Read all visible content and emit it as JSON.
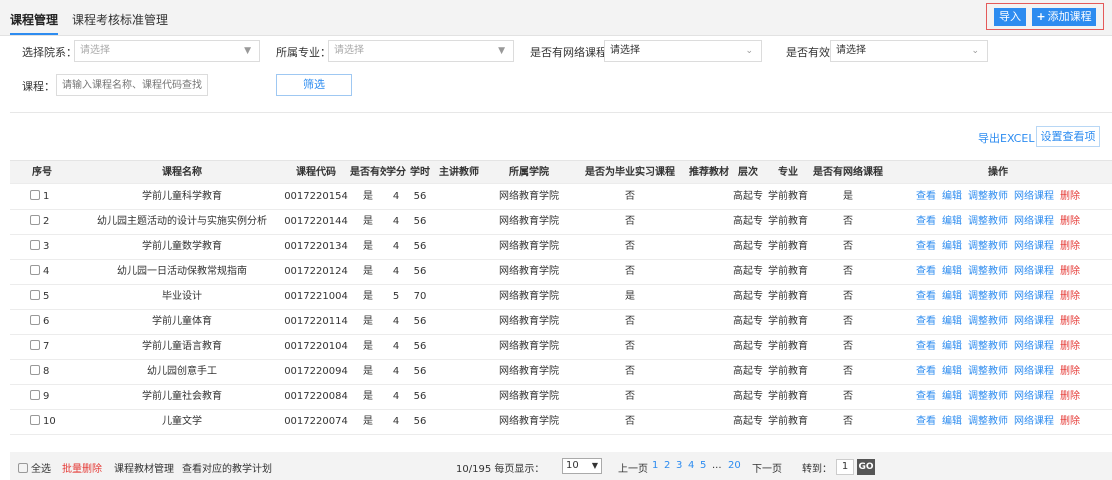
{
  "tabs": [
    {
      "label": "课程管理",
      "active": true
    },
    {
      "label": "课程考核标准管理",
      "active": false
    }
  ],
  "top_actions": {
    "import_label": "导入",
    "add_label": "添加课程",
    "add_icon": "plus-icon",
    "accent": "#2d8cf0",
    "highlight_border": "#e45a5a"
  },
  "filters": {
    "college": {
      "label": "选择院系：",
      "placeholder": "请选择"
    },
    "major": {
      "label": "所属专业：",
      "placeholder": "请选择"
    },
    "online": {
      "label": "是否有网络课程:",
      "value": "请选择"
    },
    "valid": {
      "label": "是否有效:",
      "value": "请选择"
    },
    "course": {
      "label": "课程：",
      "placeholder": "请输入课程名称、课程代码查找"
    },
    "submit_label": "筛选"
  },
  "toolbar": {
    "export_label": "导出EXCEL",
    "config_label": "设置查看项"
  },
  "table": {
    "headers": {
      "no": "序号",
      "name": "课程名称",
      "code": "课程代码",
      "valid": "是否有效",
      "credit": "学分",
      "hours": "学时",
      "teacher": "主讲教师",
      "college": "所属学院",
      "intern": "是否为毕业实习课程",
      "book": "推荐教材",
      "level": "层次",
      "major": "专业",
      "online": "是否有网络课程",
      "ops": "操作"
    },
    "ops": {
      "view": "查看",
      "edit": "编辑",
      "adjust": "调整教师",
      "online": "网络课程",
      "delete": "删除"
    },
    "rows": [
      {
        "no": "1",
        "name": "学前儿童科学教育",
        "code": "0017220154",
        "valid": "是",
        "credit": "4",
        "hours": "56",
        "teacher": "",
        "college": "网络教育学院",
        "intern": "否",
        "book": "",
        "level": "高起专",
        "major": "学前教育",
        "online": "是"
      },
      {
        "no": "2",
        "name": "幼儿园主题活动的设计与实施实例分析",
        "code": "0017220144",
        "valid": "是",
        "credit": "4",
        "hours": "56",
        "teacher": "",
        "college": "网络教育学院",
        "intern": "否",
        "book": "",
        "level": "高起专",
        "major": "学前教育",
        "online": "否"
      },
      {
        "no": "3",
        "name": "学前儿童数学教育",
        "code": "0017220134",
        "valid": "是",
        "credit": "4",
        "hours": "56",
        "teacher": "",
        "college": "网络教育学院",
        "intern": "否",
        "book": "",
        "level": "高起专",
        "major": "学前教育",
        "online": "否"
      },
      {
        "no": "4",
        "name": "幼儿园一日活动保教常规指南",
        "code": "0017220124",
        "valid": "是",
        "credit": "4",
        "hours": "56",
        "teacher": "",
        "college": "网络教育学院",
        "intern": "否",
        "book": "",
        "level": "高起专",
        "major": "学前教育",
        "online": "否"
      },
      {
        "no": "5",
        "name": "毕业设计",
        "code": "0017221004",
        "valid": "是",
        "credit": "5",
        "hours": "70",
        "teacher": "",
        "college": "网络教育学院",
        "intern": "是",
        "book": "",
        "level": "高起专",
        "major": "学前教育",
        "online": "否"
      },
      {
        "no": "6",
        "name": "学前儿童体育",
        "code": "0017220114",
        "valid": "是",
        "credit": "4",
        "hours": "56",
        "teacher": "",
        "college": "网络教育学院",
        "intern": "否",
        "book": "",
        "level": "高起专",
        "major": "学前教育",
        "online": "否"
      },
      {
        "no": "7",
        "name": "学前儿童语言教育",
        "code": "0017220104",
        "valid": "是",
        "credit": "4",
        "hours": "56",
        "teacher": "",
        "college": "网络教育学院",
        "intern": "否",
        "book": "",
        "level": "高起专",
        "major": "学前教育",
        "online": "否"
      },
      {
        "no": "8",
        "name": "幼儿园创意手工",
        "code": "0017220094",
        "valid": "是",
        "credit": "4",
        "hours": "56",
        "teacher": "",
        "college": "网络教育学院",
        "intern": "否",
        "book": "",
        "level": "高起专",
        "major": "学前教育",
        "online": "否"
      },
      {
        "no": "9",
        "name": "学前儿童社会教育",
        "code": "0017220084",
        "valid": "是",
        "credit": "4",
        "hours": "56",
        "teacher": "",
        "college": "网络教育学院",
        "intern": "否",
        "book": "",
        "level": "高起专",
        "major": "学前教育",
        "online": "否"
      },
      {
        "no": "10",
        "name": "儿童文学",
        "code": "0017220074",
        "valid": "是",
        "credit": "4",
        "hours": "56",
        "teacher": "",
        "college": "网络教育学院",
        "intern": "否",
        "book": "",
        "level": "高起专",
        "major": "学前教育",
        "online": "否"
      }
    ]
  },
  "footer": {
    "select_all": "全选",
    "batch_delete": "批量删除",
    "materials": "课程教材管理",
    "plan": "查看对应的教学计划",
    "summary": "10/195 每页显示：",
    "page_size": "10",
    "prev": "上一页",
    "pages": [
      "1",
      "2",
      "3",
      "4",
      "5",
      "...",
      "20"
    ],
    "next": "下一页",
    "jump_label": "转到：",
    "jump_value": "1",
    "go": "GO"
  }
}
